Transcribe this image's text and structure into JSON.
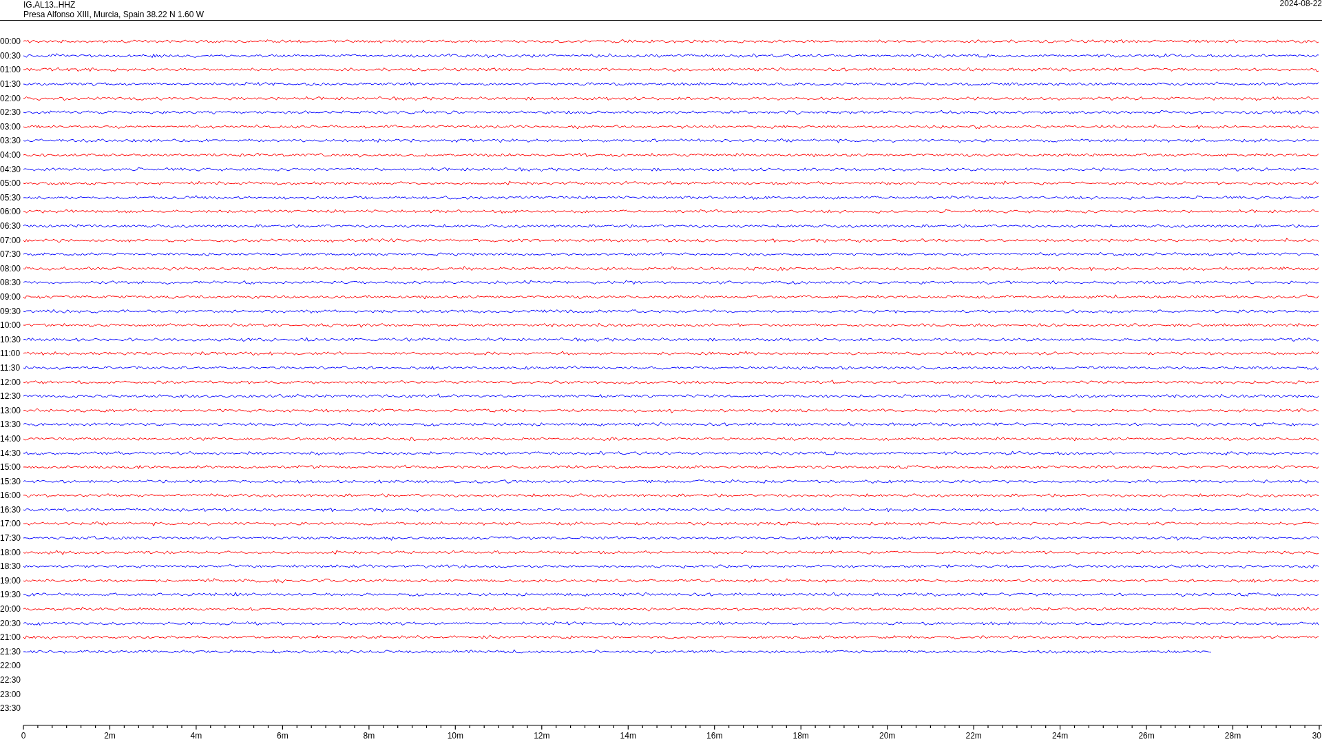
{
  "header": {
    "station": "IG.AL13..HHZ",
    "location": "Presa Alfonso XIII, Murcia, Spain  38.22 N 1.60 W",
    "date": "2024-08-22"
  },
  "rows": [
    {
      "label": "00:00",
      "color": "#ff0000"
    },
    {
      "label": "00:30",
      "color": "#0000ff"
    },
    {
      "label": "01:00",
      "color": "#ff0000"
    },
    {
      "label": "01:30",
      "color": "#0000ff"
    },
    {
      "label": "02:00",
      "color": "#ff0000"
    },
    {
      "label": "02:30",
      "color": "#0000ff"
    },
    {
      "label": "03:00",
      "color": "#ff0000"
    },
    {
      "label": "03:30",
      "color": "#0000ff"
    },
    {
      "label": "04:00",
      "color": "#ff0000"
    },
    {
      "label": "04:30",
      "color": "#0000ff"
    },
    {
      "label": "05:00",
      "color": "#ff0000"
    },
    {
      "label": "05:30",
      "color": "#0000ff"
    },
    {
      "label": "06:00",
      "color": "#ff0000"
    },
    {
      "label": "06:30",
      "color": "#0000ff"
    },
    {
      "label": "07:00",
      "color": "#ff0000"
    },
    {
      "label": "07:30",
      "color": "#0000ff"
    },
    {
      "label": "08:00",
      "color": "#ff0000"
    },
    {
      "label": "08:30",
      "color": "#0000ff"
    },
    {
      "label": "09:00",
      "color": "#ff0000"
    },
    {
      "label": "09:30",
      "color": "#0000ff"
    },
    {
      "label": "10:00",
      "color": "#ff0000"
    },
    {
      "label": "10:30",
      "color": "#0000ff"
    },
    {
      "label": "11:00",
      "color": "#ff0000"
    },
    {
      "label": "11:30",
      "color": "#0000ff"
    },
    {
      "label": "12:00",
      "color": "#ff0000"
    },
    {
      "label": "12:30",
      "color": "#0000ff"
    },
    {
      "label": "13:00",
      "color": "#ff0000"
    },
    {
      "label": "13:30",
      "color": "#0000ff"
    },
    {
      "label": "14:00",
      "color": "#ff0000"
    },
    {
      "label": "14:30",
      "color": "#0000ff"
    },
    {
      "label": "15:00",
      "color": "#ff0000"
    },
    {
      "label": "15:30",
      "color": "#0000ff"
    },
    {
      "label": "16:00",
      "color": "#ff0000"
    },
    {
      "label": "16:30",
      "color": "#0000ff"
    },
    {
      "label": "17:00",
      "color": "#ff0000"
    },
    {
      "label": "17:30",
      "color": "#0000ff"
    },
    {
      "label": "18:00",
      "color": "#ff0000"
    },
    {
      "label": "18:30",
      "color": "#0000ff"
    },
    {
      "label": "19:00",
      "color": "#ff0000"
    },
    {
      "label": "19:30",
      "color": "#0000ff"
    },
    {
      "label": "20:00",
      "color": "#ff0000"
    },
    {
      "label": "20:30",
      "color": "#0000ff"
    },
    {
      "label": "21:00",
      "color": "#ff0000"
    },
    {
      "label": "21:30",
      "color": "#0000ff",
      "kind": "partial"
    },
    {
      "label": "22:00"
    },
    {
      "label": "22:30"
    },
    {
      "label": "23:00"
    },
    {
      "label": "23:30"
    }
  ],
  "axis": {
    "ticks": [
      "0",
      "2m",
      "4m",
      "6m",
      "8m",
      "10m",
      "12m",
      "14m",
      "16m",
      "18m",
      "20m",
      "22m",
      "24m",
      "26m",
      "28m",
      "30"
    ]
  }
}
